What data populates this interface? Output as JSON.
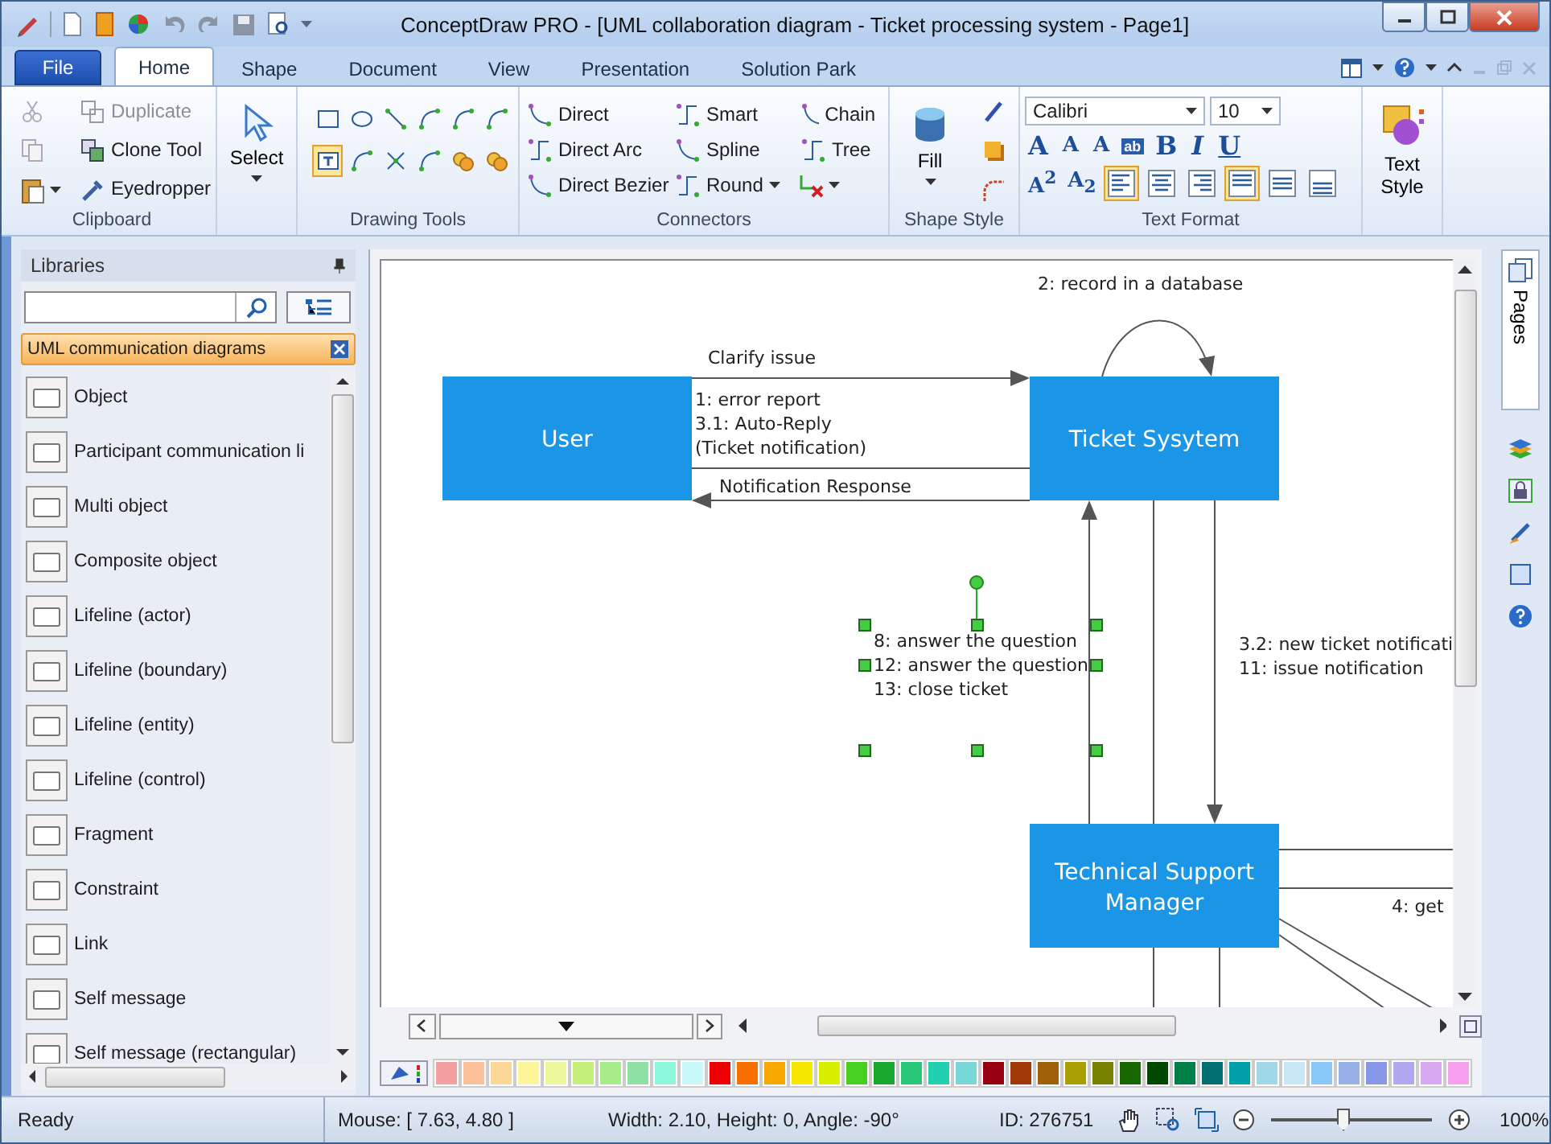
{
  "window": {
    "title": "ConceptDraw PRO - [UML collaboration diagram - Ticket processing system - Page1]"
  },
  "file_tab": "File",
  "tabs": [
    {
      "label": "Home",
      "selected": true
    },
    {
      "label": "Shape",
      "selected": false
    },
    {
      "label": "Document",
      "selected": false
    },
    {
      "label": "View",
      "selected": false
    },
    {
      "label": "Presentation",
      "selected": false
    },
    {
      "label": "Solution Park",
      "selected": false
    }
  ],
  "clipboard": {
    "title": "Clipboard",
    "items": [
      {
        "label": "Duplicate",
        "disabled": true
      },
      {
        "label": "Clone Tool",
        "disabled": false
      },
      {
        "label": "Eyedropper",
        "disabled": false
      }
    ]
  },
  "select": {
    "label": "Select"
  },
  "drawing_tools": {
    "title": "Drawing Tools",
    "tools": [
      {
        "kind": "rect",
        "selected": false
      },
      {
        "kind": "ellipse",
        "selected": false
      },
      {
        "kind": "line",
        "selected": false
      },
      {
        "kind": "arc",
        "selected": false
      },
      {
        "kind": "bezier",
        "selected": false
      },
      {
        "kind": "polyline",
        "selected": false
      },
      {
        "kind": "text",
        "selected": true
      },
      {
        "kind": "connect",
        "selected": false
      },
      {
        "kind": "scissors",
        "selected": false
      },
      {
        "kind": "curve",
        "selected": false
      },
      {
        "kind": "union",
        "selected": false
      },
      {
        "kind": "intersect",
        "selected": false
      }
    ]
  },
  "connectors": {
    "title": "Connectors",
    "items": [
      {
        "label": "Direct"
      },
      {
        "label": "Direct Arc"
      },
      {
        "label": "Direct Bezier"
      },
      {
        "label": "Smart"
      },
      {
        "label": "Spline"
      },
      {
        "label": "Round"
      },
      {
        "label": "Chain"
      },
      {
        "label": "Tree"
      }
    ]
  },
  "shape_style": {
    "title": "Shape Style",
    "fill": "Fill"
  },
  "text_format": {
    "title": "Text Format",
    "font": "Calibri",
    "size": "10",
    "glyphs": [
      "A",
      "A",
      "A",
      "ab",
      "B",
      "I",
      "U"
    ],
    "scripts": [
      "A$^{2}$",
      "A$_{2}$"
    ],
    "align": [
      {
        "kind": "left",
        "selected": true
      },
      {
        "kind": "center",
        "selected": false
      },
      {
        "kind": "right",
        "selected": false
      },
      {
        "kind": "top",
        "selected": true
      },
      {
        "kind": "middle",
        "selected": false
      },
      {
        "kind": "bottom",
        "selected": false
      }
    ]
  },
  "text_style": {
    "label": "Text Style"
  },
  "libraries": {
    "title": "Libraries",
    "library": "UML communication diagrams",
    "items": [
      {
        "label": "Object"
      },
      {
        "label": "Participant communication li"
      },
      {
        "label": "Multi object"
      },
      {
        "label": "Composite object"
      },
      {
        "label": "Lifeline (actor)"
      },
      {
        "label": "Lifeline (boundary)"
      },
      {
        "label": "Lifeline (entity)"
      },
      {
        "label": "Lifeline (control)"
      },
      {
        "label": "Fragment"
      },
      {
        "label": "Constraint"
      },
      {
        "label": "Link"
      },
      {
        "label": "Self message"
      },
      {
        "label": "Self message (rectangular)"
      }
    ]
  },
  "diagram": {
    "nodes": [
      {
        "label": [
          "User"
        ]
      },
      {
        "label": [
          "Ticket Sysytem"
        ]
      },
      {
        "label": [
          "Technical Support",
          "Manager"
        ]
      }
    ],
    "messages": [
      {
        "lines": [
          "Clarify issue"
        ]
      },
      {
        "lines": [
          "1: error report",
          "3.1: Auto-Reply",
          "(Ticket notification)"
        ]
      },
      {
        "lines": [
          "Notification Response"
        ]
      },
      {
        "lines": [
          "2: record in a database"
        ]
      },
      {
        "lines": [
          "8: answer the question",
          "12: answer the question",
          "13: close ticket"
        ],
        "selected": true
      },
      {
        "lines": [
          "3.2: new ticket notificati",
          "11: issue notification"
        ]
      },
      {
        "lines": [
          "4: get"
        ]
      }
    ]
  },
  "side_tab": "Pages",
  "palette": [
    {
      "color": "#f4a0a0"
    },
    {
      "color": "#fcc09a"
    },
    {
      "color": "#fcd898"
    },
    {
      "color": "#fcf59a"
    },
    {
      "color": "#ecf79c"
    },
    {
      "color": "#c6f07c"
    },
    {
      "color": "#a6ec8a"
    },
    {
      "color": "#8ee0a4"
    },
    {
      "color": "#8ef8dc"
    },
    {
      "color": "#c8f8f8"
    },
    {
      "color": "#ee0000"
    },
    {
      "color": "#f87000"
    },
    {
      "color": "#f8a800"
    },
    {
      "color": "#f8e800"
    },
    {
      "color": "#d8f000"
    },
    {
      "color": "#48d020"
    },
    {
      "color": "#18a830"
    },
    {
      "color": "#28c878"
    },
    {
      "color": "#20d0b0"
    },
    {
      "color": "#78d8d8"
    },
    {
      "color": "#980010"
    },
    {
      "color": "#a03808"
    },
    {
      "color": "#a06008"
    },
    {
      "color": "#a8a000"
    },
    {
      "color": "#788000"
    },
    {
      "color": "#186800"
    },
    {
      "color": "#004800"
    },
    {
      "color": "#008048"
    },
    {
      "color": "#007070"
    },
    {
      "color": "#00a0a8"
    },
    {
      "color": "#a0d8e8"
    },
    {
      "color": "#c8e8f8"
    },
    {
      "color": "#88c8f8"
    },
    {
      "color": "#98b0e8"
    },
    {
      "color": "#8898e8"
    },
    {
      "color": "#b0a8f0"
    },
    {
      "color": "#d8a8f0"
    },
    {
      "color": "#f8a0f0"
    }
  ],
  "status": {
    "state": "Ready",
    "mouse": "Mouse: [ 7.63, 4.80 ]",
    "size": "Width: 2.10,  Height: 0,  Angle: -90°",
    "id": "ID: 276751",
    "zoom": "100%",
    "level": 0.45
  }
}
